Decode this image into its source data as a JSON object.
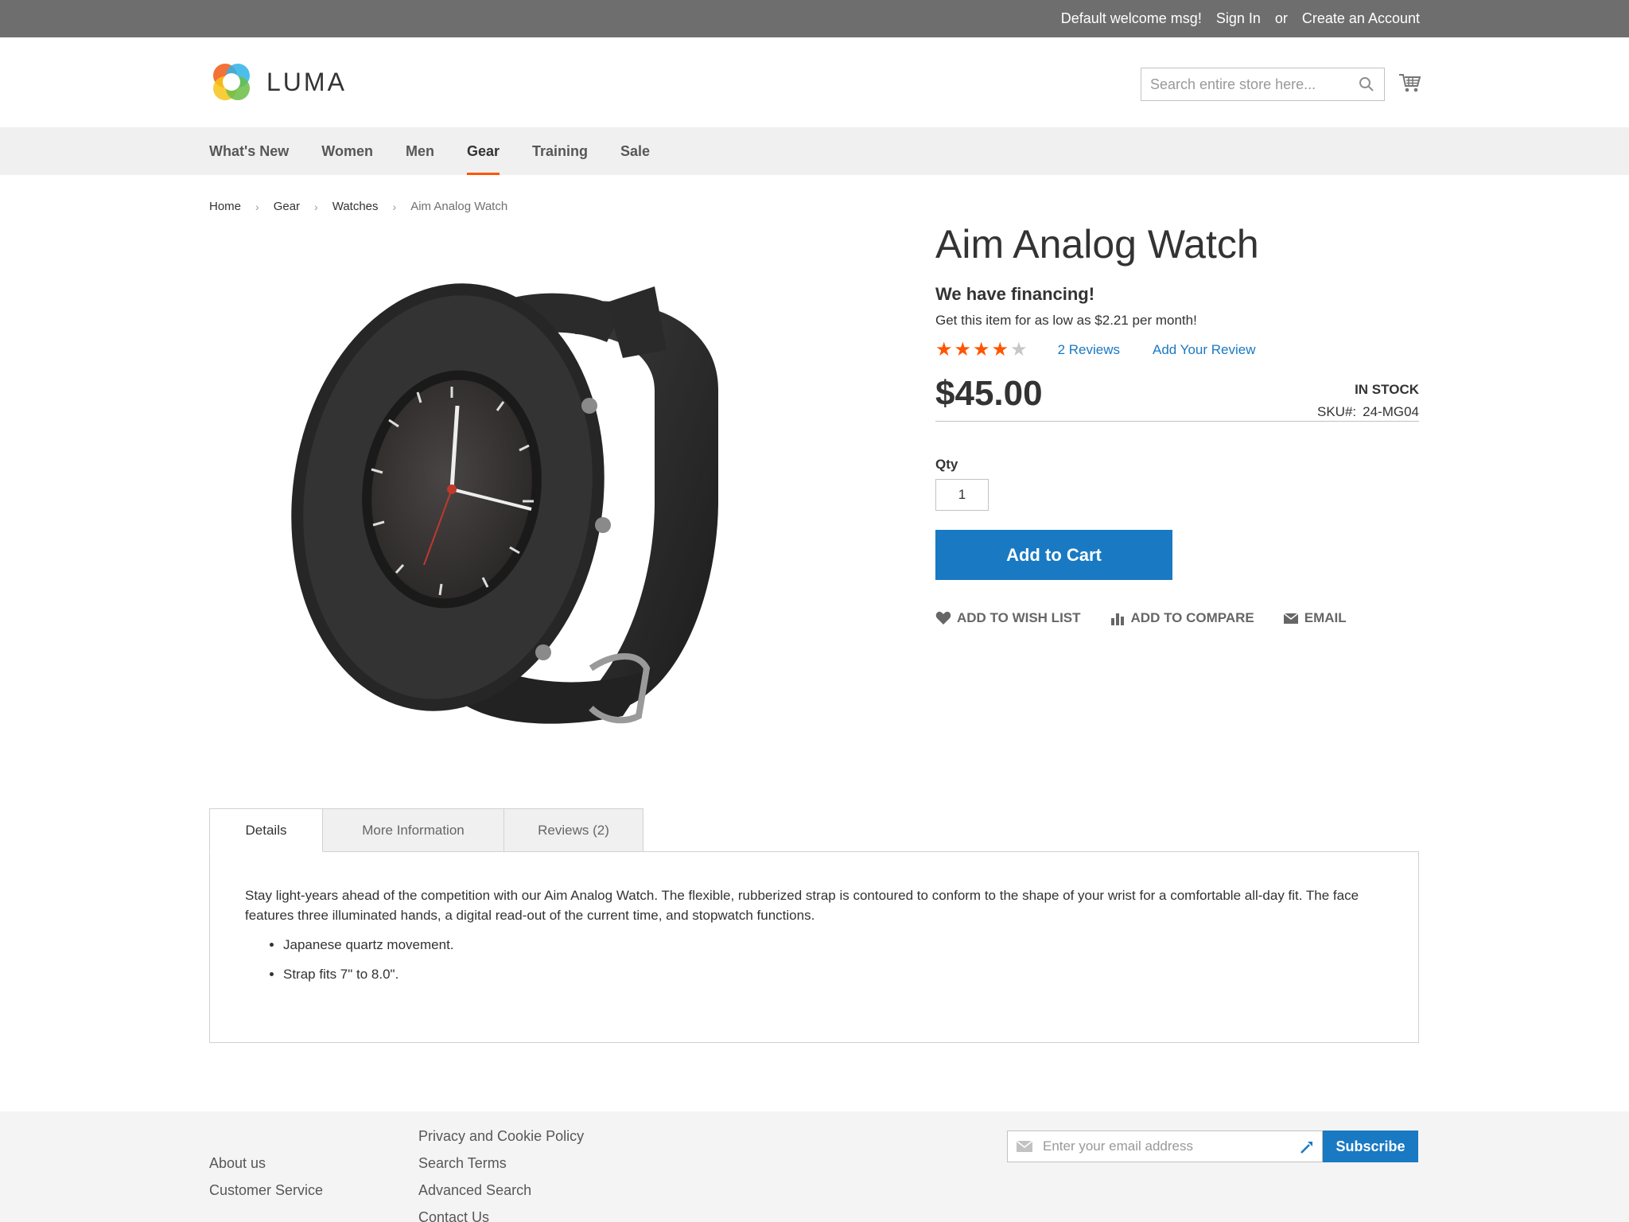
{
  "topbar": {
    "welcome": "Default welcome msg!",
    "sign_in": "Sign In",
    "or": "or",
    "create_account": "Create an Account"
  },
  "header": {
    "logo_text": "LUMA",
    "search_placeholder": "Search entire store here...",
    "search_icon": "search-icon",
    "cart_icon": "cart-icon"
  },
  "nav": {
    "items": [
      {
        "label": "What's New"
      },
      {
        "label": "Women"
      },
      {
        "label": "Men"
      },
      {
        "label": "Gear",
        "active": true
      },
      {
        "label": "Training"
      },
      {
        "label": "Sale"
      }
    ]
  },
  "breadcrumb": [
    "Home",
    "Gear",
    "Watches",
    "Aim Analog Watch"
  ],
  "product": {
    "title": "Aim Analog Watch",
    "financing_heading": "We have financing!",
    "financing_text": "Get this item for as low as $2.21 per month!",
    "rating_stars": 4,
    "rating_max": 5,
    "reviews_link": "2 Reviews",
    "add_review_link": "Add Your Review",
    "price": "$45.00",
    "stock": "IN STOCK",
    "sku_label": "SKU#:",
    "sku": "24-MG04",
    "qty_label": "Qty",
    "qty_value": "1",
    "add_to_cart": "Add to Cart",
    "actions": {
      "wishlist": "ADD TO WISH LIST",
      "compare": "ADD TO COMPARE",
      "email": "EMAIL"
    }
  },
  "tabs": {
    "items": [
      "Details",
      "More Information",
      "Reviews (2)"
    ],
    "active": "Details",
    "details_text": "Stay light-years ahead of the competition with our Aim Analog Watch. The flexible, rubberized strap is contoured to conform to the shape of your wrist for a comfortable all-day fit. The face features three illuminated hands, a digital read-out of the current time, and stopwatch functions.",
    "bullets": [
      "Japanese quartz movement.",
      "Strap fits 7\" to 8.0\"."
    ]
  },
  "footer": {
    "col1": [
      "About us",
      "Customer Service"
    ],
    "col2": [
      "Privacy and Cookie Policy",
      "Search Terms",
      "Advanced Search",
      "Contact Us"
    ],
    "newsletter_placeholder": "Enter your email address",
    "subscribe": "Subscribe"
  },
  "colors": {
    "accent_blue": "#1979c3",
    "nav_underline": "#ff5501",
    "star": "#ff5501",
    "topbar_bg": "#6e6e6e"
  }
}
